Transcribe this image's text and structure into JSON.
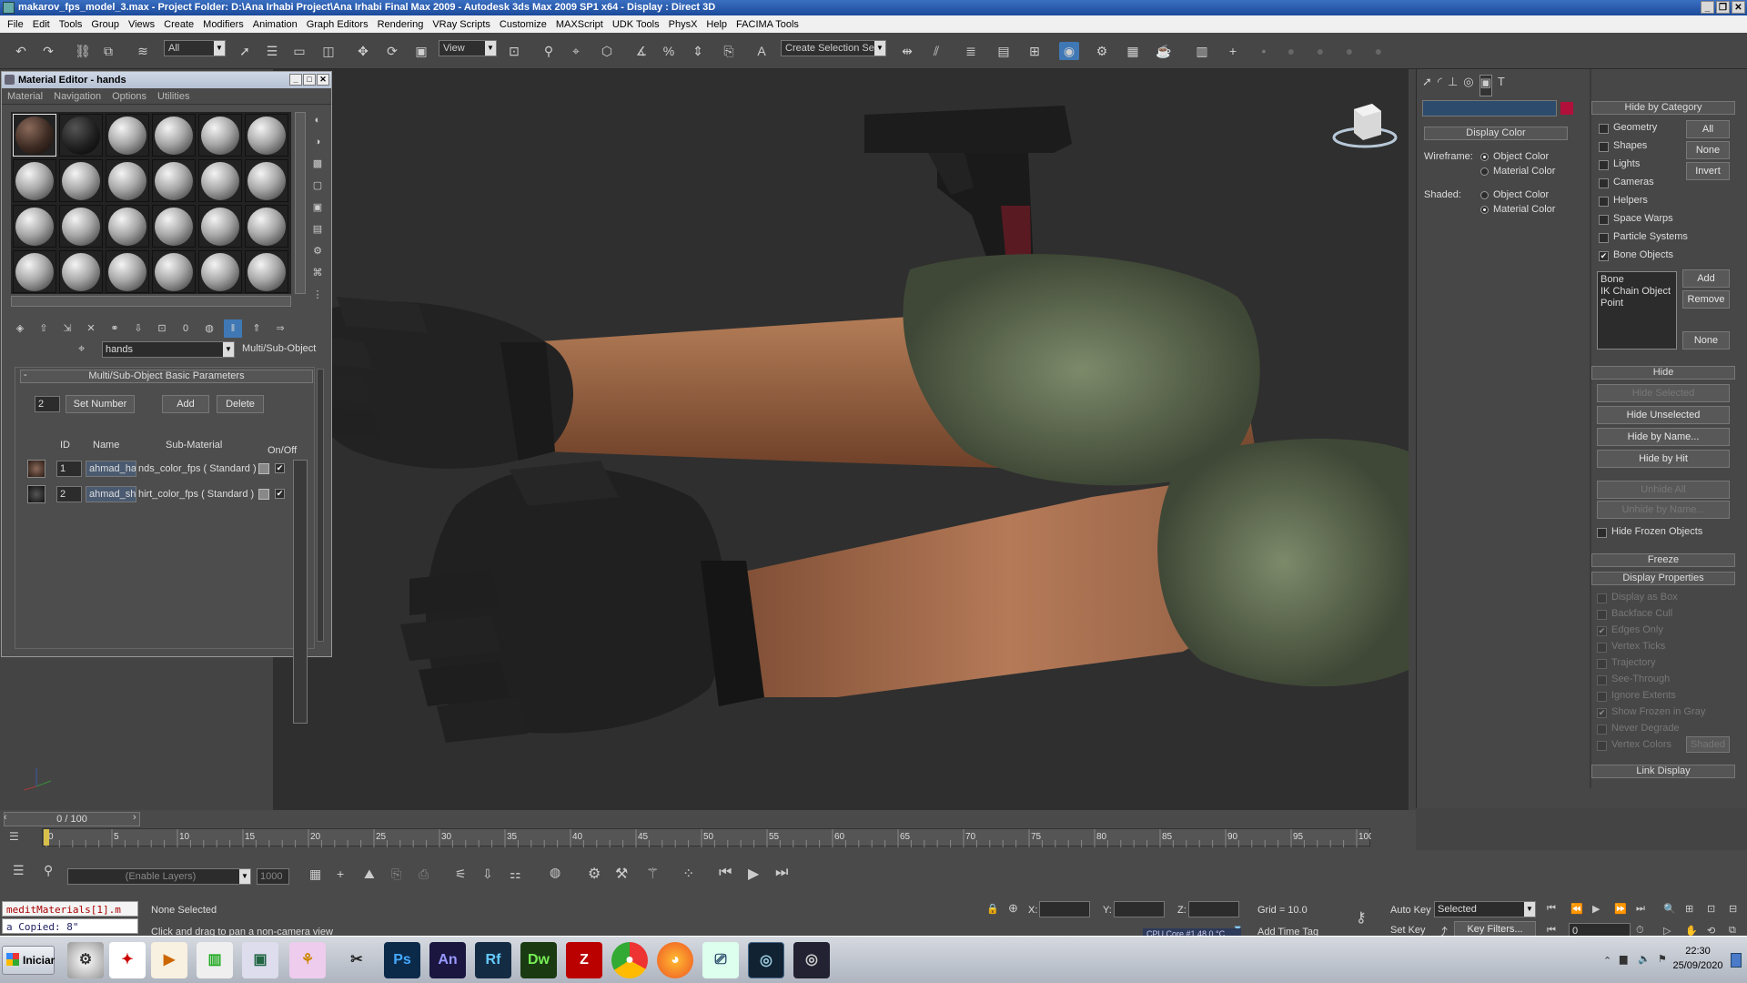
{
  "window": {
    "title": "makarov_fps_model_3.max    - Project Folder: D:\\Ana Irhabi Project\\Ana Irhabi Final Max 2009    - Autodesk 3ds Max  2009 SP1  x64     - Display : Direct 3D"
  },
  "menu": [
    "File",
    "Edit",
    "Tools",
    "Group",
    "Views",
    "Create",
    "Modifiers",
    "Animation",
    "Graph Editors",
    "Rendering",
    "VRay Scripts",
    "Customize",
    "MAXScript",
    "UDK Tools",
    "PhysX",
    "Help",
    "FACIMA Tools"
  ],
  "toolbar": {
    "selection_filter": "All",
    "ref_coord": "View",
    "named_selection": "Create Selection Se"
  },
  "material_editor": {
    "title": "Material Editor - hands",
    "menu": [
      "Material",
      "Navigation",
      "Options",
      "Utilities"
    ],
    "material_name": "hands",
    "material_type": "Multi/Sub-Object",
    "rollout_title": "Multi/Sub-Object Basic Parameters",
    "set_number_value": "2",
    "set_number_label": "Set Number",
    "add_label": "Add",
    "delete_label": "Delete",
    "columns": [
      "ID",
      "Name",
      "Sub-Material",
      "On/Off"
    ],
    "rows": [
      {
        "id": "1",
        "name": "ahmad_ha",
        "submaterial": "nds_color_fps  ( Standard )"
      },
      {
        "id": "2",
        "name": "ahmad_shi",
        "submaterial": "hirt_color_fps  ( Standard )"
      }
    ]
  },
  "command_panel": {
    "display_color": {
      "title": "Display Color",
      "wireframe_label": "Wireframe:",
      "shaded_label": "Shaded:",
      "object_color": "Object Color",
      "material_color": "Material Color"
    },
    "hide_by_category": {
      "title": "Hide by Category",
      "items": [
        "Geometry",
        "Shapes",
        "Lights",
        "Cameras",
        "Helpers",
        "Space Warps",
        "Particle Systems",
        "Bone Objects"
      ],
      "all_label": "All",
      "none_label": "None",
      "invert_label": "Invert",
      "list_items": [
        "Bone",
        "IK Chain Object",
        "Point"
      ],
      "add_label": "Add",
      "remove_label": "Remove",
      "none2_label": "None"
    },
    "hide": {
      "title": "Hide",
      "buttons": [
        "Hide Selected",
        "Hide Unselected",
        "Hide by Name...",
        "Hide by Hit",
        "Unhide All",
        "Unhide by Name..."
      ],
      "hide_frozen": "Hide Frozen Objects"
    },
    "freeze_title": "Freeze",
    "display_properties": {
      "title": "Display Properties",
      "items": [
        "Display as Box",
        "Backface Cull",
        "Edges Only",
        "Vertex Ticks",
        "Trajectory",
        "See-Through",
        "Ignore Extents",
        "Show Frozen in Gray",
        "Never Degrade",
        "Vertex Colors"
      ],
      "shaded_btn": "Shaded"
    },
    "link_display_title": "Link Display"
  },
  "timeline": {
    "frame_counter": "0 / 100",
    "ticks": [
      "0",
      "5",
      "10",
      "15",
      "20",
      "25",
      "30",
      "35",
      "40",
      "45",
      "50",
      "55",
      "60",
      "65",
      "70",
      "75",
      "80",
      "85",
      "90",
      "95",
      "100"
    ],
    "position": 0,
    "total_frames": 100
  },
  "status": {
    "layers_placeholder": "(Enable Layers)",
    "layers_value": "1000",
    "maxscript_listener": "meditMaterials[1].m",
    "maxscript_output": "a Copied: 8\"",
    "selection": "None Selected",
    "prompt": "Click and drag to pan a non-camera view",
    "x_label": "X:",
    "y_label": "Y:",
    "z_label": "Z:",
    "grid": "Grid = 10.0",
    "add_time_tag": "Add Time Tag",
    "cpu": "CPU Core #1    48,0 °C",
    "auto_key": "Auto Key",
    "set_key": "Set Key",
    "key_mode": "Selected",
    "key_filters": "Key Filters...",
    "current_frame": "0"
  },
  "taskbar": {
    "start_label": "Iniciar",
    "apps": [
      "Ps",
      "An",
      "Rf",
      "Dw"
    ],
    "time": "22:30",
    "date": "25/09/2020"
  },
  "colors": {
    "accent": "#1c4a9a",
    "viewport_bg": "#2f2f2f",
    "panel_bg": "#474747",
    "color_swatch": "#b0103a"
  }
}
